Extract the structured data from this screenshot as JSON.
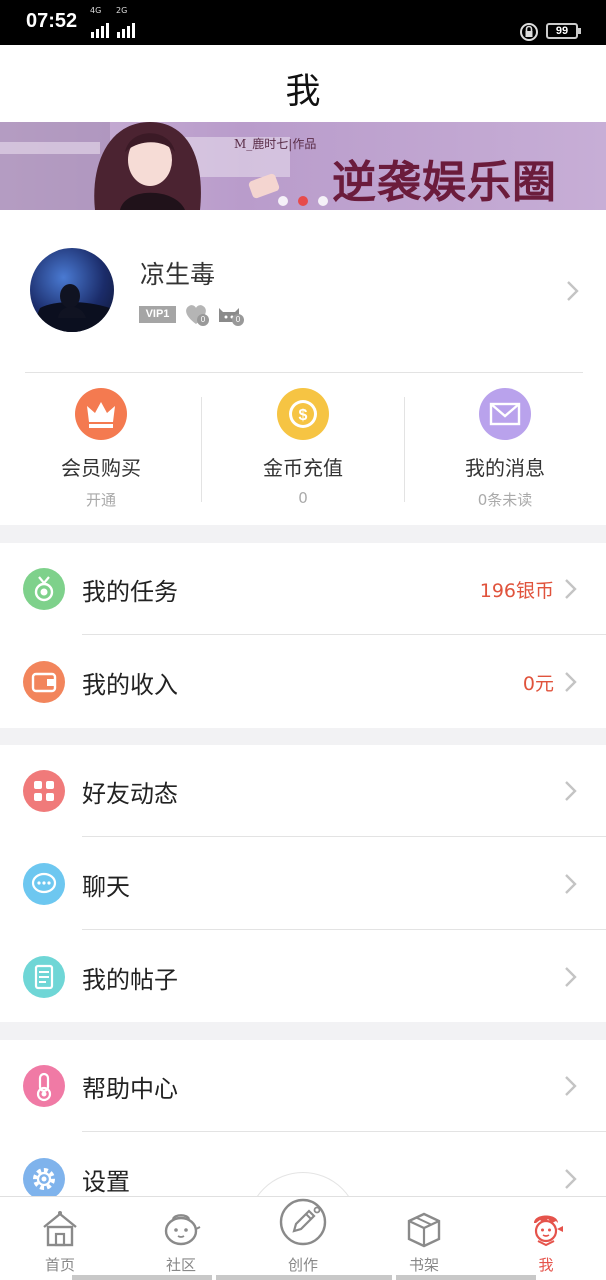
{
  "status_bar": {
    "time": "07:52",
    "net1": "4G",
    "net2": "2G",
    "battery": "99"
  },
  "header": {
    "title": "我"
  },
  "banner": {
    "author": "M_鹿时七|作品",
    "title": "逆袭娱乐圈",
    "dots": 3,
    "active_dot": 2
  },
  "profile": {
    "name": "凉生毒",
    "vip": "VIP1",
    "badge1_count": "0",
    "badge2_count": "0"
  },
  "quick_actions": [
    {
      "label": "会员购买",
      "sub": "开通",
      "color": "#f47a50",
      "icon": "crown-icon"
    },
    {
      "label": "金币充值",
      "sub": "0",
      "color": "#f6c443",
      "icon": "coin-icon"
    },
    {
      "label": "我的消息",
      "sub": "0条未读",
      "color": "#b9a2ec",
      "icon": "envelope-icon"
    }
  ],
  "group1": [
    {
      "label": "我的任务",
      "value": "196银币",
      "color": "#7ed18b",
      "icon": "medal-icon"
    },
    {
      "label": "我的收入",
      "value": "0元",
      "color": "#f2855c",
      "icon": "wallet-icon"
    }
  ],
  "group2": [
    {
      "label": "好友动态",
      "color": "#f07a7a",
      "icon": "grid-icon"
    },
    {
      "label": "聊天",
      "color": "#6dc7f0",
      "icon": "chat-icon"
    },
    {
      "label": "我的帖子",
      "color": "#6fd6d6",
      "icon": "document-icon"
    }
  ],
  "group3": [
    {
      "label": "帮助中心",
      "color": "#f07aa5",
      "icon": "thermometer-icon"
    },
    {
      "label": "设置",
      "color": "#7fb3ec",
      "icon": "gear-icon"
    }
  ],
  "tabs": [
    {
      "label": "首页",
      "icon": "house-icon"
    },
    {
      "label": "社区",
      "icon": "community-icon"
    },
    {
      "label": "创作",
      "icon": "pen-icon"
    },
    {
      "label": "书架",
      "icon": "box-icon"
    },
    {
      "label": "我",
      "icon": "me-icon",
      "active": true
    }
  ],
  "colors": {
    "accent": "#e5534b",
    "value_red": "#e0533c"
  }
}
